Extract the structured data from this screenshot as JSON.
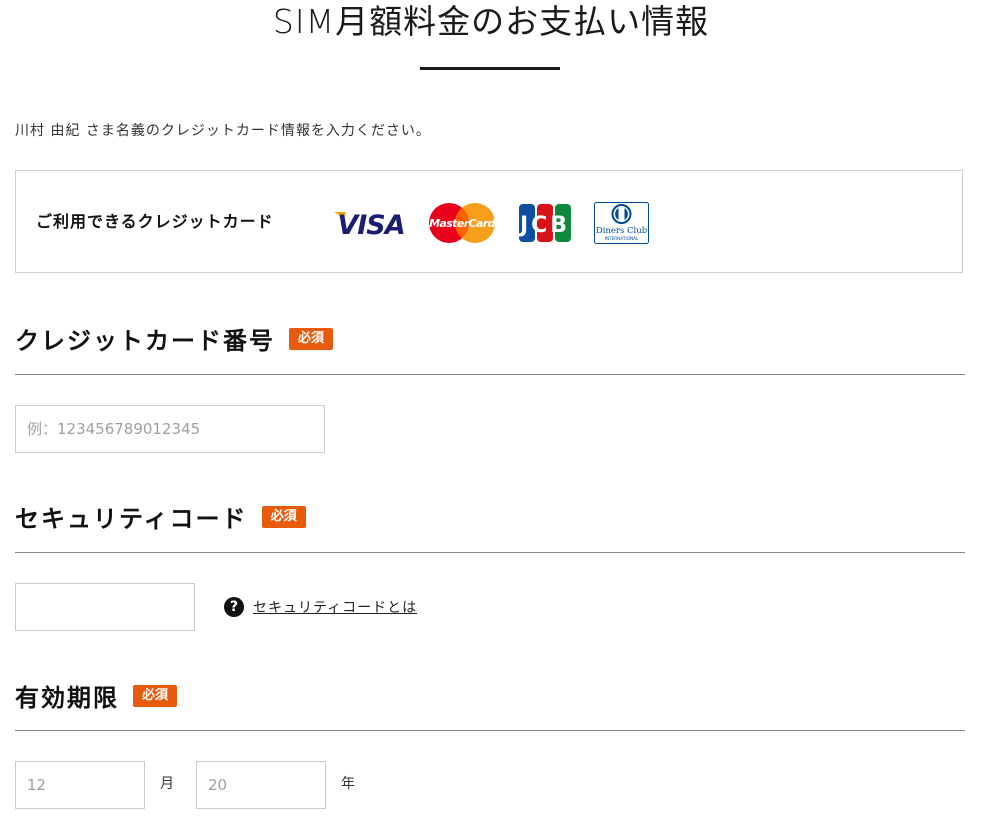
{
  "header": {
    "title": "SIM月額料金のお支払い情報"
  },
  "intro": {
    "text": "川村 由紀 さま名義のクレジットカード情報を入力ください。"
  },
  "accepted_cards": {
    "label": "ご利用できるクレジットカード",
    "brands": {
      "visa": "VISA",
      "mastercard": "MasterCard",
      "jcb": "JCB",
      "diners_line1": "Diners Club",
      "diners_line2": "INTERNATIONAL"
    }
  },
  "required_badge": "必須",
  "card_number": {
    "label": "クレジットカード番号",
    "placeholder": "例：123456789012345",
    "value": ""
  },
  "security_code": {
    "label": "セキュリティコード",
    "value": "",
    "help_icon": "?",
    "help_link": "セキュリティコードとは"
  },
  "expiry": {
    "label": "有効期限",
    "month_placeholder": "12",
    "month_unit": "月",
    "year_placeholder": "20",
    "year_unit": "年"
  },
  "colors": {
    "badge": "#e85a0c",
    "visa_blue": "#1a1f71",
    "visa_gold": "#f7a600",
    "mc_red": "#eb001b",
    "mc_orange": "#f79e1b",
    "jcb_blue": "#0b4ea2",
    "jcb_red": "#d7141a",
    "jcb_green": "#0f8a3c",
    "diners_blue": "#004a97"
  }
}
